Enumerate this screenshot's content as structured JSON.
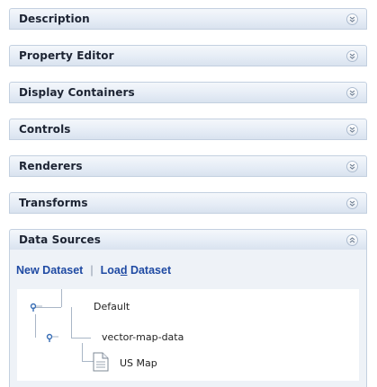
{
  "panels": [
    {
      "title": "Description",
      "state": "collapsed"
    },
    {
      "title": "Property Editor",
      "state": "collapsed"
    },
    {
      "title": "Display Containers",
      "state": "collapsed"
    },
    {
      "title": "Controls",
      "state": "collapsed"
    },
    {
      "title": "Renderers",
      "state": "collapsed"
    },
    {
      "title": "Transforms",
      "state": "collapsed"
    },
    {
      "title": "Data Sources",
      "state": "expanded"
    }
  ],
  "data_sources": {
    "new_dataset": "New Dataset",
    "load_dataset": {
      "before": "Loa",
      "mnemonic": "d",
      "after": " Dataset"
    },
    "tree": {
      "root": "Default",
      "child": "vector-map-data",
      "leaf": "US Map"
    }
  },
  "colors": {
    "panel_border": "#c3d0e0",
    "link": "#1f4aa3",
    "tree_line": "#a9b6c6"
  },
  "icons": {
    "collapsed": "chevron-double-down-icon",
    "expanded": "chevron-double-up-icon",
    "tree_node": "node-expander-icon",
    "leaf": "document-icon"
  }
}
